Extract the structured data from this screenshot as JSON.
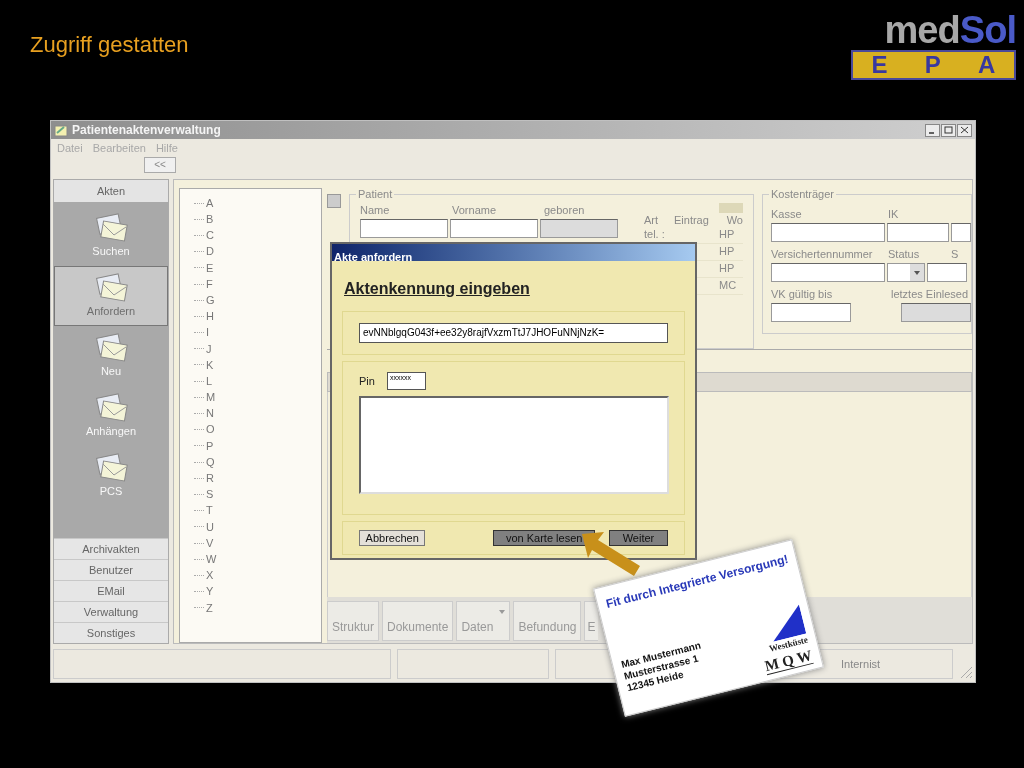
{
  "slide": {
    "title": "Zugriff gestatten",
    "logo": {
      "part_1": "med",
      "part_2": "Sol",
      "letters": [
        "E",
        "P",
        "A"
      ]
    }
  },
  "window": {
    "title": "Patientenaktenverwaltung",
    "menu": [
      "Datei",
      "Bearbeiten",
      "Hilfe"
    ],
    "collapse_button": "<<"
  },
  "nav": {
    "header": "Akten",
    "items": [
      {
        "label": "Suchen",
        "selected": false
      },
      {
        "label": "Anfordern",
        "selected": true
      },
      {
        "label": "Neu",
        "selected": false
      },
      {
        "label": "Anhängen",
        "selected": false
      },
      {
        "label": "PCS",
        "selected": false
      }
    ],
    "sections": [
      "Archivakten",
      "Benutzer",
      "EMail",
      "Verwaltung",
      "Sonstiges"
    ]
  },
  "tree": {
    "items": [
      "A",
      "B",
      "C",
      "D",
      "E",
      "F",
      "G",
      "H",
      "I",
      "J",
      "K",
      "L",
      "M",
      "N",
      "O",
      "P",
      "Q",
      "R",
      "S",
      "T",
      "U",
      "V",
      "W",
      "X",
      "Y",
      "Z"
    ]
  },
  "patient": {
    "legend": "Patient",
    "labels": [
      "Name",
      "Vorname",
      "geboren"
    ],
    "contact_columns": [
      "Art",
      "Eintrag",
      "Wo"
    ],
    "contacts": [
      {
        "art": "tel. :",
        "wo": "HP"
      },
      {
        "wo": "HP"
      },
      {
        "wo": "HP"
      },
      {
        "wo": "MC"
      }
    ]
  },
  "insurer": {
    "legend": "Kostenträger",
    "row_1": [
      "Kasse",
      "IK"
    ],
    "row_2": [
      "Versichertennummer",
      "Status",
      "S"
    ],
    "row_3": [
      "VK gültig bis",
      "letztes Einlesed"
    ]
  },
  "tabs": [
    {
      "label": "Struktur"
    },
    {
      "label": "Dokumente"
    },
    {
      "label": "Daten",
      "kind": "dropdown"
    },
    {
      "label": "Befundung"
    },
    {
      "label": "E"
    }
  ],
  "status_bar": {
    "cells": [
      "Internist"
    ]
  },
  "dialog": {
    "title": "Akte anfordern",
    "heading": "Aktenkennung eingeben",
    "id_value": "evNNblgqG043f+ee32y8rajfVxzmTtJ7JHOFuNNjNzK=",
    "pin_label": "Pin",
    "pin_value": "xxxxxx",
    "buttons": [
      {
        "label": "Abbrechen",
        "kind": "light"
      },
      {
        "label": "von Karte lesen",
        "kind": "dark"
      },
      {
        "label": "Weiter",
        "kind": "dark"
      }
    ]
  },
  "card": {
    "headline": "Fit durch Integrierte Versorgung!",
    "lines": [
      "Max Mustermann",
      "Musterstrasse 1",
      "12345 Heide"
    ],
    "logo_word": "Westküste",
    "logo_letters": "M Q W"
  }
}
